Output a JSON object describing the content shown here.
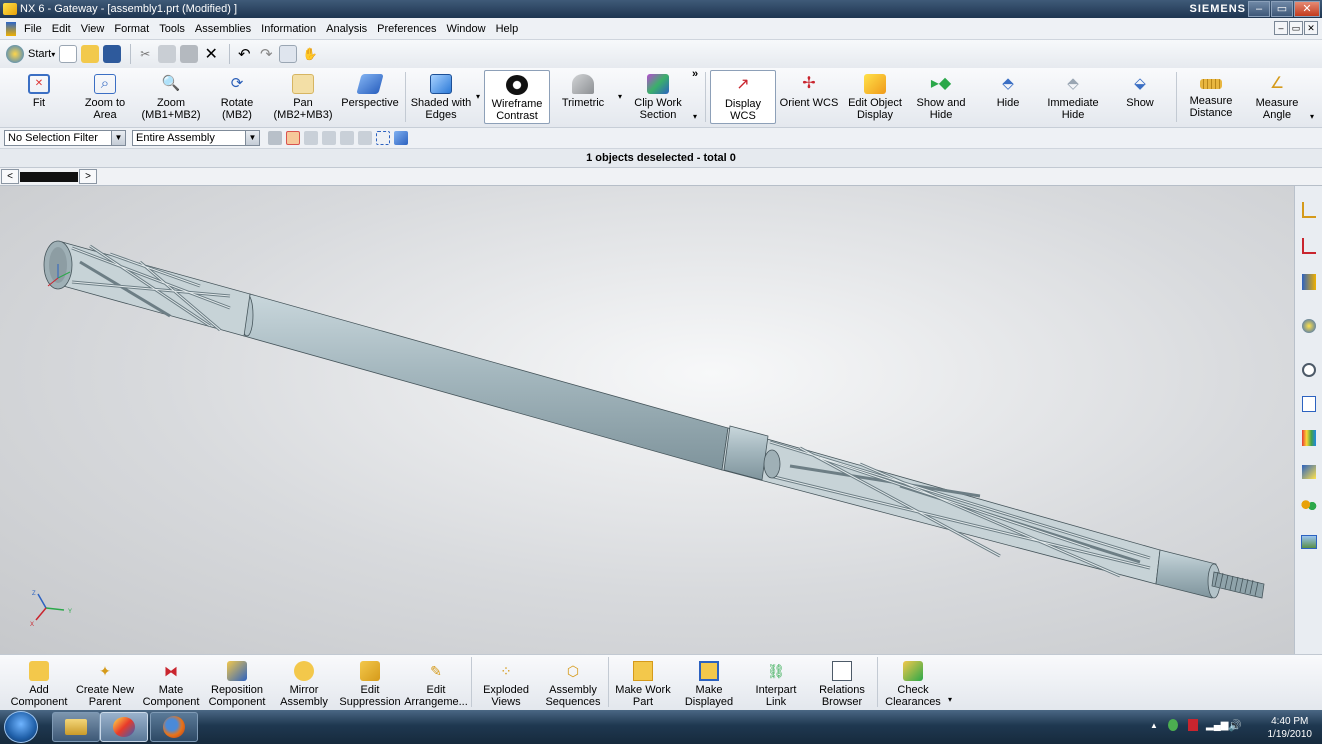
{
  "window": {
    "title": "NX 6 - Gateway - [assembly1.prt (Modified) ]",
    "brand": "SIEMENS",
    "controls": {
      "minimize": "–",
      "restore": "▭",
      "close": "✕"
    }
  },
  "menubar": {
    "items": [
      "File",
      "Edit",
      "View",
      "Format",
      "Tools",
      "Assemblies",
      "Information",
      "Analysis",
      "Preferences",
      "Window",
      "Help"
    ]
  },
  "standard_toolbar": {
    "start_label": "Start",
    "icons": [
      "new-icon",
      "open-icon",
      "save-icon",
      "cut-icon",
      "copy-icon",
      "paste-icon",
      "delete-icon",
      "undo-icon",
      "redo-icon",
      "repeat-command-icon",
      "touch-mode-icon"
    ]
  },
  "view_toolbar": {
    "buttons": [
      {
        "label": "Fit",
        "icon": "fit-icon"
      },
      {
        "label": "Zoom to Area",
        "icon": "zoom-area-icon"
      },
      {
        "label": "Zoom (MB1+MB2)",
        "icon": "zoom-icon"
      },
      {
        "label": "Rotate (MB2)",
        "icon": "rotate-icon"
      },
      {
        "label": "Pan (MB2+MB3)",
        "icon": "pan-icon"
      },
      {
        "label": "Perspective",
        "icon": "perspective-icon"
      },
      {
        "label": "Shaded with Edges",
        "icon": "shaded-edges-icon"
      },
      {
        "label": "Wireframe Contrast",
        "icon": "wireframe-contrast-icon",
        "selected": true
      },
      {
        "label": "Trimetric",
        "icon": "trimetric-icon"
      },
      {
        "label": "Clip Work Section",
        "icon": "clip-section-icon"
      },
      {
        "label": "Display WCS",
        "icon": "display-wcs-icon",
        "selected": true
      },
      {
        "label": "Orient WCS",
        "icon": "orient-wcs-icon"
      },
      {
        "label": "Edit Object Display",
        "icon": "edit-object-display-icon"
      },
      {
        "label": "Show and Hide",
        "icon": "show-and-hide-icon"
      },
      {
        "label": "Hide",
        "icon": "hide-icon"
      },
      {
        "label": "Immediate Hide",
        "icon": "immediate-hide-icon"
      },
      {
        "label": "Show",
        "icon": "show-icon"
      },
      {
        "label": "Measure Distance",
        "icon": "measure-distance-icon"
      },
      {
        "label": "Measure Angle",
        "icon": "measure-angle-icon"
      }
    ],
    "overflow": "»"
  },
  "filter_bar": {
    "selection_filter": "No Selection Filter",
    "scope": "Entire Assembly"
  },
  "status": {
    "message": "1 objects deselected  - total 0"
  },
  "tabs": {
    "prev": "<",
    "next": ">"
  },
  "viewport": {
    "triad_labels": {
      "z": "Z",
      "y": "Y",
      "x": "X"
    }
  },
  "resource_bar": {
    "icons": [
      "assembly-navigator-icon",
      "constraint-navigator-icon",
      "part-navigator-icon",
      "web-browser-icon",
      "history-icon",
      "system-materials-icon",
      "visualization-palette-icon",
      "process-studio-icon",
      "roles-icon",
      "system-scenes-icon"
    ]
  },
  "assemblies_toolbar": {
    "buttons": [
      {
        "label": "Add Component",
        "icon": "add-component-icon"
      },
      {
        "label": "Create New Parent",
        "icon": "create-new-parent-icon"
      },
      {
        "label": "Mate Component",
        "icon": "mate-component-icon"
      },
      {
        "label": "Reposition Component",
        "icon": "reposition-component-icon"
      },
      {
        "label": "Mirror Assembly",
        "icon": "mirror-assembly-icon"
      },
      {
        "label": "Edit Suppression",
        "icon": "edit-suppression-icon"
      },
      {
        "label": "Edit Arrangeme...",
        "icon": "edit-arrangements-icon"
      },
      {
        "label": "Exploded Views",
        "icon": "exploded-views-icon"
      },
      {
        "label": "Assembly Sequences",
        "icon": "assembly-sequences-icon"
      },
      {
        "label": "Make Work Part",
        "icon": "make-work-part-icon"
      },
      {
        "label": "Make Displayed",
        "icon": "make-displayed-icon"
      },
      {
        "label": "Interpart Link",
        "icon": "interpart-link-icon"
      },
      {
        "label": "Relations Browser",
        "icon": "relations-browser-icon"
      },
      {
        "label": "Check Clearances",
        "icon": "check-clearances-icon"
      }
    ]
  },
  "taskbar": {
    "apps": [
      "windows-explorer-icon",
      "nx-icon",
      "firefox-icon"
    ],
    "time": "4:40 PM",
    "date": "1/19/2010"
  },
  "colors": {
    "titlebar": "#1e3550",
    "toolbar": "#eef1f5",
    "part": "#a9bcc4",
    "viewport_bg": "#d8dadd"
  }
}
